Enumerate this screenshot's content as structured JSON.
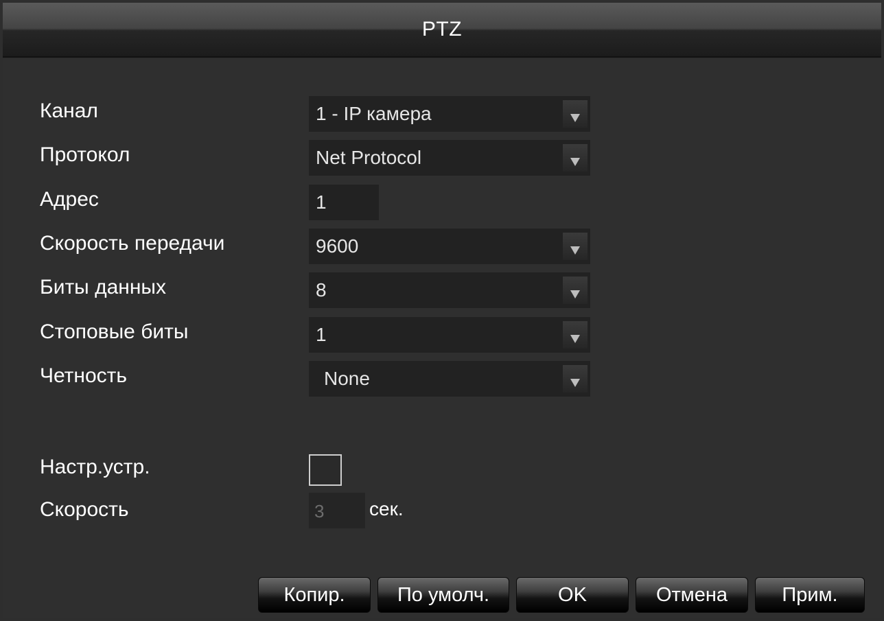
{
  "window": {
    "title": "PTZ"
  },
  "form": {
    "channel": {
      "label": "Канал",
      "value": "1 - IP камера"
    },
    "protocol": {
      "label": "Протокол",
      "value": "Net Protocol"
    },
    "address": {
      "label": "Адрес",
      "value": "1"
    },
    "baud_rate": {
      "label": "Скорость передачи",
      "value": "9600"
    },
    "data_bits": {
      "label": "Биты данных",
      "value": "8"
    },
    "stop_bits": {
      "label": "Стоповые биты",
      "value": "1"
    },
    "parity": {
      "label": "Четность",
      "value": "None"
    },
    "device_setup": {
      "label": "Настр.устр.",
      "checked": false
    },
    "speed": {
      "label": "Скорость",
      "value": "3",
      "unit": "сек."
    }
  },
  "buttons": {
    "copy": "Копир.",
    "default": "По умолч.",
    "ok": "OK",
    "cancel": "Отмена",
    "apply": "Прим."
  },
  "icons": {
    "dropdown": "chevron-down-icon"
  },
  "colors": {
    "background": "#2f2f2f",
    "field": "#222222",
    "text": "#ffffff"
  }
}
